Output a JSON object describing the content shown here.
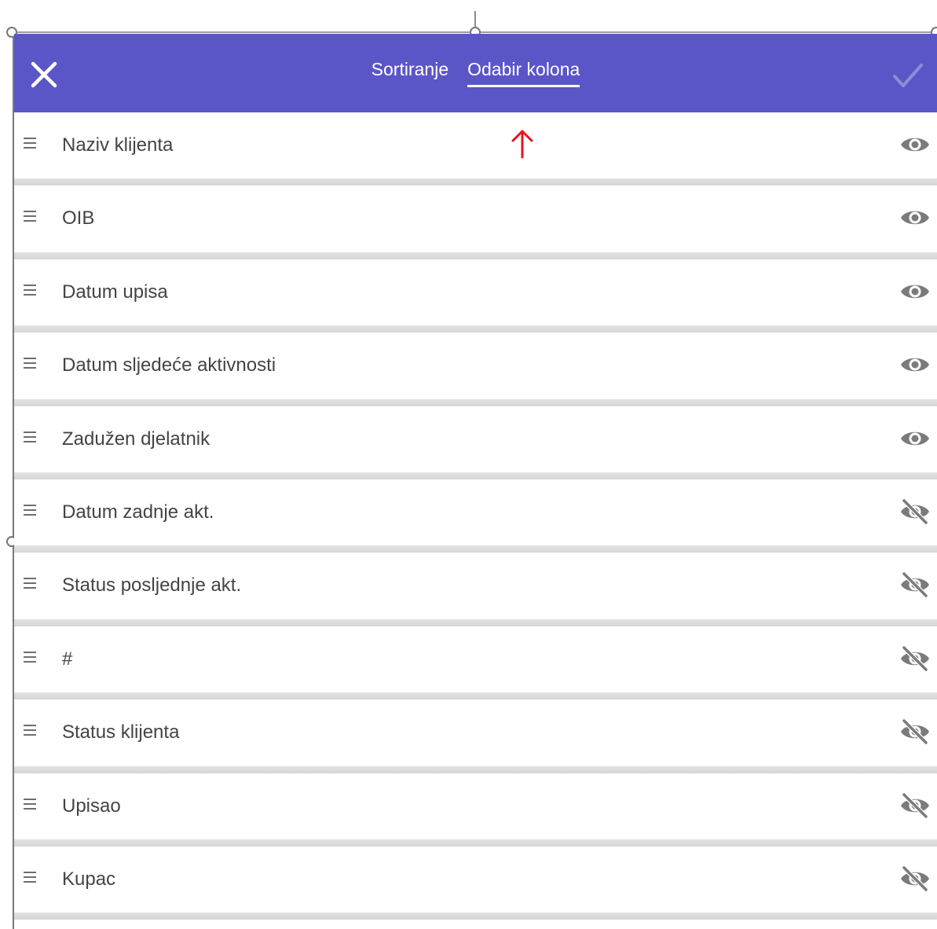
{
  "header": {
    "tabs": [
      {
        "label": "Sortiranje",
        "active": false
      },
      {
        "label": "Odabir kolona",
        "active": true
      }
    ],
    "close_icon": "close-icon",
    "confirm_icon": "checkmark-icon",
    "background_color": "#5b56c7"
  },
  "columns": [
    {
      "label": "Naziv klijenta",
      "visible": true
    },
    {
      "label": "OIB",
      "visible": true
    },
    {
      "label": "Datum upisa",
      "visible": true
    },
    {
      "label": "Datum sljedeće aktivnosti",
      "visible": true
    },
    {
      "label": "Zadužen djelatnik",
      "visible": true
    },
    {
      "label": "Datum zadnje akt.",
      "visible": false
    },
    {
      "label": "Status posljednje akt.",
      "visible": false
    },
    {
      "label": "#",
      "visible": false
    },
    {
      "label": "Status klijenta",
      "visible": false
    },
    {
      "label": "Upisao",
      "visible": false
    },
    {
      "label": "Kupac",
      "visible": false
    }
  ],
  "annotation": {
    "arrow_color": "#e8131c"
  }
}
